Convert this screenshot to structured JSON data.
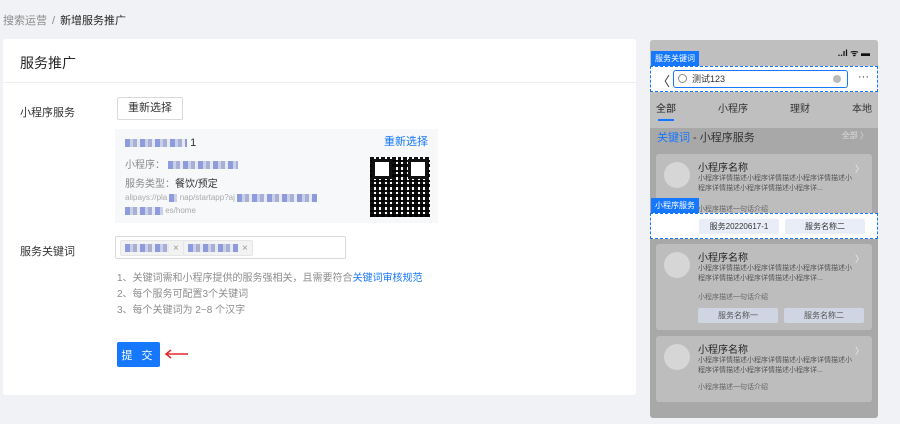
{
  "breadcrumb": {
    "parent": "搜索运营",
    "separator": "/",
    "current": "新增服务推广"
  },
  "card": {
    "title": "服务推广"
  },
  "miniprogram": {
    "label": "小程序服务",
    "reselect_button": "重新选择",
    "selected": {
      "title_suffix": "1",
      "reselect_link": "重新选择",
      "name_label": "小程序：",
      "type_label": "服务类型：",
      "type_value": "餐饮/预定",
      "path_prefix": "alipays://pla",
      "path_mid": "nap/startapp?aj",
      "path_suffix": "es/home"
    }
  },
  "keywords": {
    "label": "服务关键词",
    "tags": [
      {
        "remove": "×"
      },
      {
        "remove": "×"
      }
    ],
    "tips": [
      {
        "text": "1、关键词需和小程序提供的服务强相关，且需要符合",
        "link": "关键词审核规范"
      },
      {
        "text": "2、每个服务可配置3个关键词"
      },
      {
        "text": "3、每个关键词为 2~8 个汉字"
      }
    ]
  },
  "submit_label": "提 交",
  "preview": {
    "keyword_tag": "服务关键词",
    "service_tag": "小程序服务",
    "status_icons": "..ıl ᯤ ▬",
    "search_value": "测试123",
    "more": "···",
    "back": "〈",
    "tabs": [
      "全部",
      "小程序",
      "理财",
      "本地"
    ],
    "section": {
      "prefix": "关键词",
      "dash": " - ",
      "title": "小程序服务",
      "all": "全部 〉"
    },
    "items": [
      {
        "name": "小程序名称",
        "desc": "小程序详情描述小程序详情描述小程序详情描述小程序详情描述小程序详情描述小程序详...",
        "intro": "小程序描述一句话介绍",
        "services": [
          "服务20220617-1",
          "服务名称二"
        ]
      },
      {
        "name": "小程序名称",
        "desc": "小程序详情描述小程序详情描述小程序详情描述小程序详情描述小程序详情描述小程序详...",
        "intro": "小程序描述一句话介绍",
        "services": [
          "服务名称一",
          "服务名称二"
        ]
      },
      {
        "name": "小程序名称",
        "desc": "小程序详情描述小程序详情描述小程序详情描述小程序详情描述小程序详情描述小程序详...",
        "intro": "小程序描述一句话介绍",
        "services": []
      }
    ]
  },
  "colors": {
    "primary": "#1677ff",
    "arrow": "#e5282a"
  }
}
